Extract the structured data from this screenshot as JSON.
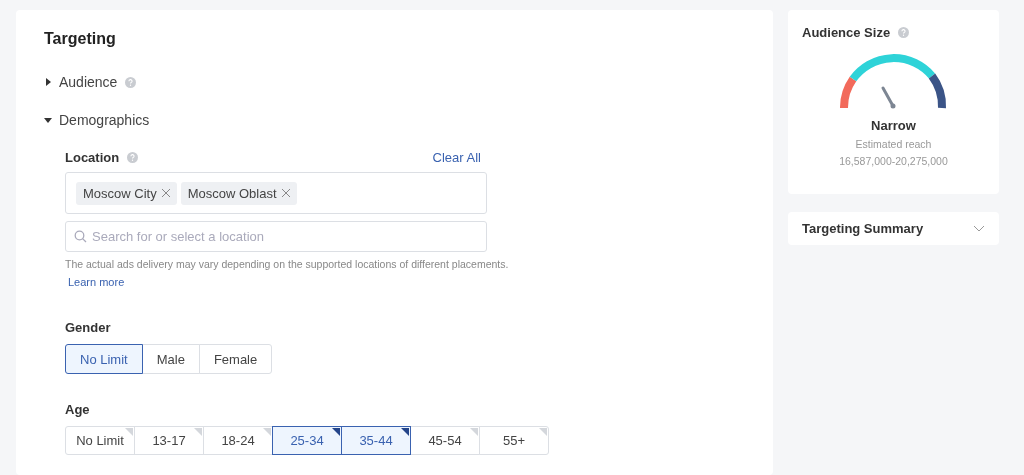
{
  "targeting": {
    "title": "Targeting",
    "sections": [
      {
        "label": "Audience",
        "help": true,
        "expanded": false
      },
      {
        "label": "Demographics",
        "help": false,
        "expanded": true
      }
    ],
    "location": {
      "label": "Location",
      "clear_all": "Clear All",
      "tags": [
        "Moscow City",
        "Moscow Oblast"
      ],
      "search": {
        "placeholder": "Search for or select a location"
      },
      "note": "The actual ads delivery may vary depending on the supported locations of different placements.",
      "learn_more": "Learn more"
    },
    "gender": {
      "label": "Gender",
      "options": [
        {
          "label": "No Limit",
          "selected": true
        },
        {
          "label": "Male",
          "selected": false
        },
        {
          "label": "Female",
          "selected": false
        }
      ]
    },
    "age": {
      "label": "Age",
      "options": [
        {
          "label": "No Limit",
          "selected": false
        },
        {
          "label": "13-17",
          "selected": false
        },
        {
          "label": "18-24",
          "selected": false
        },
        {
          "label": "25-34",
          "selected": true
        },
        {
          "label": "35-44",
          "selected": true
        },
        {
          "label": "45-54",
          "selected": false
        },
        {
          "label": "55+",
          "selected": false
        }
      ]
    }
  },
  "audience_size": {
    "title": "Audience Size",
    "verdict": "Narrow",
    "reach_label": "Estimated reach",
    "reach": "16,587,000-20,275,000"
  },
  "targeting_summary": {
    "title": "Targeting Summary",
    "expanded": false
  }
}
